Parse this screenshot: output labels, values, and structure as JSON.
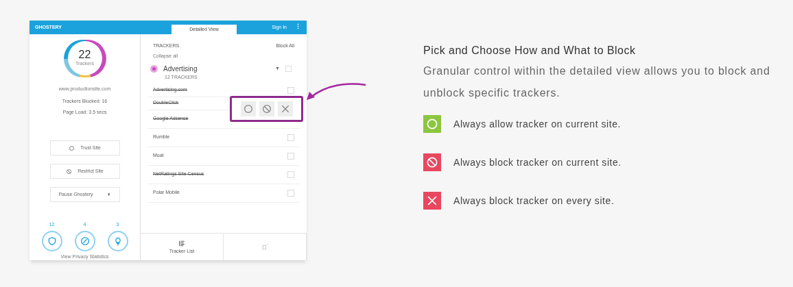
{
  "app_screenshot": {
    "header": {
      "logo": "GHOSTERY",
      "tab": "Detailed View",
      "sign_in": "Sign In",
      "menu": "⋮"
    },
    "summary": {
      "count": "22",
      "count_label": "Trackers",
      "url": "www.productionsite.com",
      "blocked": "Trackers Blocked: 16",
      "page_load": "Page Load: 3.5 secs"
    },
    "actions": [
      {
        "kind": "trust",
        "label": "Trust Site"
      },
      {
        "kind": "restrict",
        "label": "Restrict Site"
      },
      {
        "kind": "pause",
        "label": "Pause Ghostery",
        "caret": "▼"
      }
    ],
    "stats": [
      {
        "kind": "shield",
        "count": "12"
      },
      {
        "kind": "check",
        "count": "4"
      },
      {
        "kind": "bulb",
        "count": "3"
      }
    ],
    "stats_label": "View Privacy Statistics",
    "trackers_title": "TRACKERS",
    "block_all": "Block All",
    "collapse": "Collapse all",
    "category": {
      "name": "Advertising",
      "count": "12 TRACKERS",
      "expanded": true,
      "caret": "▼",
      "checked": false
    },
    "trackers": [
      {
        "name": "Advertising.com",
        "blocked": true,
        "checked": false
      },
      {
        "name": "DoubleClick",
        "blocked": true
      },
      {
        "name": "Google Adsense",
        "blocked": true
      },
      {
        "name": "Rumble",
        "blocked": false,
        "checked": false
      },
      {
        "name": "Moat",
        "blocked": false,
        "checked": false
      },
      {
        "name": "NetRatings Site Census",
        "blocked": true,
        "checked": false
      },
      {
        "name": "Polar Mobile",
        "blocked": false,
        "checked": false
      }
    ],
    "bottom_tabs": [
      {
        "kind": "list",
        "label": "Tracker List",
        "selected": true
      },
      {
        "kind": "settings",
        "selected": false
      }
    ]
  },
  "feature": {
    "title": "Pick and Choose How and What to Block",
    "description": "Granular control within the detailed view allows you to block and unblock specific trackers.",
    "legend": [
      {
        "kind": "allow",
        "color": "#8cc63f",
        "text": "Always allow tracker on current site."
      },
      {
        "kind": "restrict",
        "color": "#e8475f",
        "text": "Always block tracker on current site."
      },
      {
        "kind": "block",
        "color": "#e8475f",
        "text": "Always block tracker on every site."
      }
    ]
  }
}
